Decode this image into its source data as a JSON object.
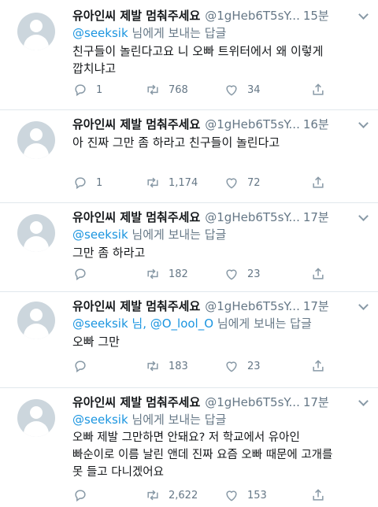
{
  "tweets": [
    {
      "name": "유아인씨 제발 멈춰주세요",
      "handle": "@1gHeb6T5sY...",
      "time": "15분",
      "reply_mention": "@seeksik",
      "reply_suffix": " 님에게 보내는 답글",
      "text_line1": "친구들이 놀린다고요 니 오빠 트위터에서 왜 이렇게",
      "text_line2": "깝치냐고",
      "replies": "1",
      "retweets": "768",
      "likes": "34"
    },
    {
      "name": "유아인씨 제발 멈춰주세요",
      "handle": "@1gHeb6T5sY...",
      "time": "16분",
      "text_line1": "아 진짜 그만 좀 하라고 친구들이 놀린다고",
      "replies": "1",
      "retweets": "1,174",
      "likes": "72"
    },
    {
      "name": "유아인씨 제발 멈춰주세요",
      "handle": "@1gHeb6T5sY...",
      "time": "17분",
      "reply_mention": "@seeksik",
      "reply_suffix": " 님에게 보내는 답글",
      "text_line1": "그만 좀 하라고",
      "replies": "",
      "retweets": "182",
      "likes": "23"
    },
    {
      "name": "유아인씨 제발 멈춰주세요",
      "handle": "@1gHeb6T5sY...",
      "time": "17분",
      "reply_mention": "@seeksik 님, @O_lool_O",
      "reply_suffix": " 님에게 보내는 답글",
      "text_line1": "오빠 그만",
      "replies": "",
      "retweets": "183",
      "likes": "23"
    },
    {
      "name": "유아인씨 제발 멈춰주세요",
      "handle": "@1gHeb6T5sY...",
      "time": "17분",
      "reply_mention": "@seeksik",
      "reply_suffix": " 님에게 보내는 답글",
      "text_line1": "오빠 제발 그만하면 안돼요? 저 학교에서 유아인",
      "text_line2": "빠순이로 이름 날린 앤데 진짜 요즘 오빠 때문에 고개를",
      "text_line3": "못 들고 다니겠어요",
      "replies": "",
      "retweets": "2,622",
      "likes": "153"
    }
  ],
  "icons": {
    "reply": "reply-icon",
    "retweet": "retweet-icon",
    "like": "heart-icon",
    "share": "share-icon",
    "chevron": "chevron-down-icon",
    "avatar": "default-profile-icon"
  },
  "colors": {
    "name": "#14171a",
    "secondary": "#657786",
    "mention": "#1b95e0",
    "icon": "#8899a6",
    "divider": "#e1e8ed",
    "avatar_bg": "#ccd6dd"
  }
}
